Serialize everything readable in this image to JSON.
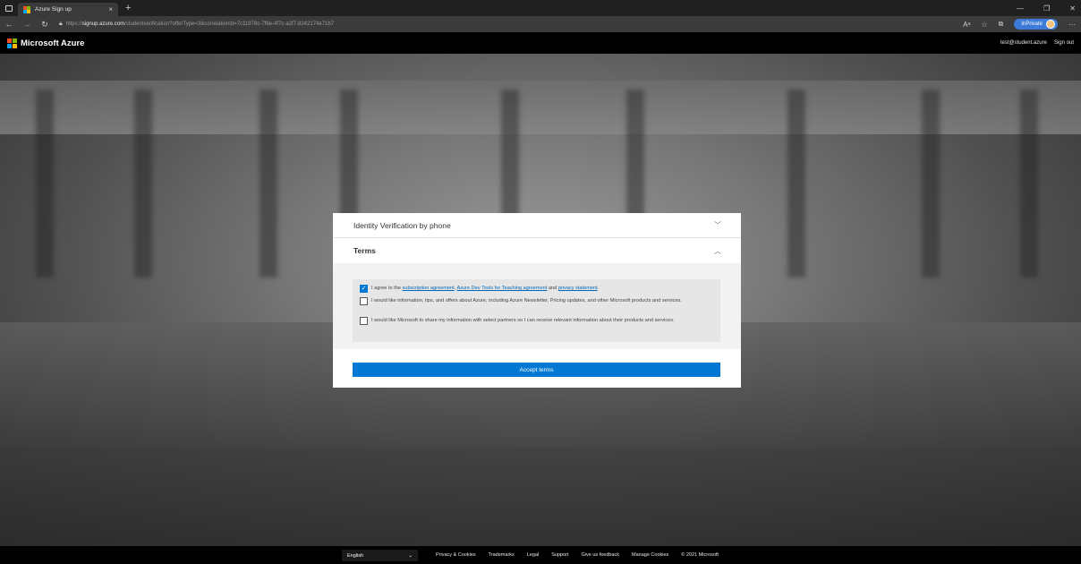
{
  "browser": {
    "tab_title": "Azure Sign up",
    "tab_close": "×",
    "new_tab": "+",
    "url_prefix": "https://",
    "url_host": "signup.azure.com",
    "url_path": "/studentverification?offerType=3&correlationId=7c11978c-7f6e-4f7c-a2f7-8242174e71b7",
    "inprivate_label": "InPrivate",
    "more": "···",
    "minimize": "—",
    "restore": "❐",
    "close": "✕"
  },
  "header": {
    "brand": "Microsoft Azure",
    "email": "test@student.azure",
    "sign_out": "Sign out"
  },
  "card": {
    "section1_title": "Identity Verification by phone",
    "section2_title": "Terms",
    "checkboxes": [
      {
        "checked": true,
        "text_before": "I agree to the ",
        "link1": "subscription agreement",
        "sep1": ", ",
        "link2": "Azure Dev Tools for Teaching agreement",
        "sep2": " and ",
        "link3": "privacy statement",
        "text_after": "."
      },
      {
        "checked": false,
        "text": "I would like information, tips, and offers about Azure, including Azure Newsletter, Pricing updates, and other Microsoft products and services."
      },
      {
        "checked": false,
        "text": "I would like Microsoft to share my information with select partners so I can receive relevant information about their products and services."
      }
    ],
    "accept_label": "Accept terms"
  },
  "footer": {
    "language": "English",
    "links": [
      "Privacy & Cookies",
      "Trademarks",
      "Legal",
      "Support",
      "Give us feedback",
      "Manage Cookies"
    ],
    "copyright": "© 2021 Microsoft"
  },
  "colors": {
    "accent": "#0078d4",
    "ms_red": "#f25022",
    "ms_green": "#7fba00",
    "ms_blue": "#00a4ef",
    "ms_yellow": "#ffb900"
  }
}
